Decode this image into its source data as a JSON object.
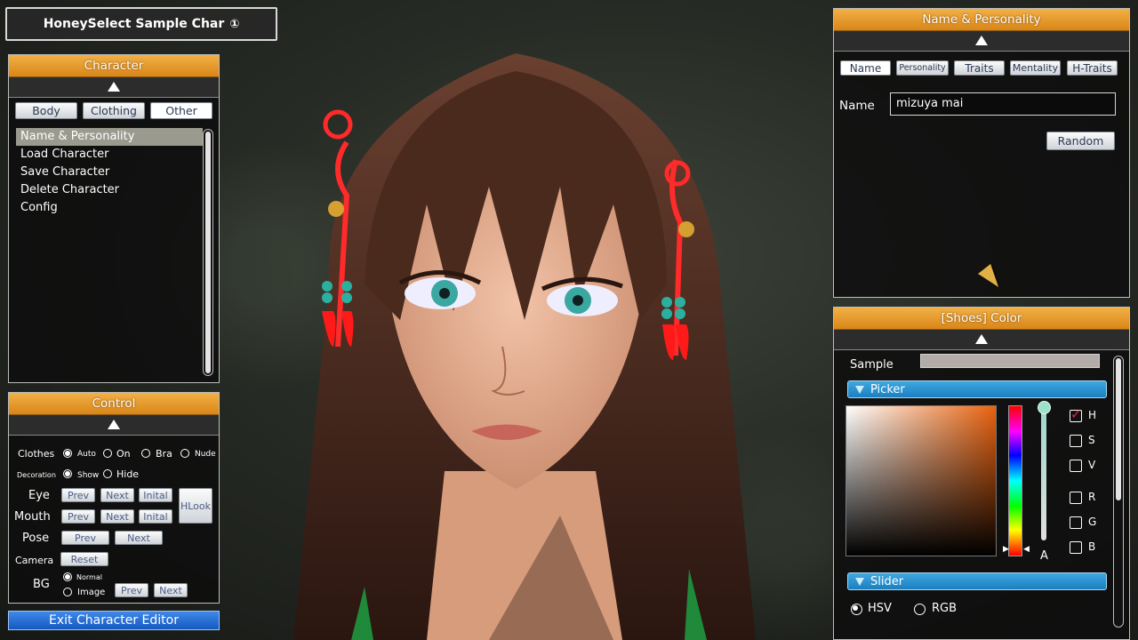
{
  "title": {
    "text": "HoneySelect Sample Char",
    "icon": "info-circle-icon",
    "icon_glyph": "①"
  },
  "character_panel": {
    "header": "Character",
    "tabs": [
      "Body",
      "Clothing",
      "Other"
    ],
    "active_tab": "Other",
    "items": [
      "Name & Personality",
      "Load Character",
      "Save Character",
      "Delete Character",
      "Config"
    ],
    "selected_item": "Name & Personality"
  },
  "control_panel": {
    "header": "Control",
    "clothes": {
      "label": "Clothes",
      "options": [
        "Auto",
        "On",
        "Bra",
        "Nude"
      ],
      "selected": "Auto"
    },
    "decoration": {
      "label": "Decoration",
      "options": [
        "Show",
        "Hide"
      ],
      "selected": "Show"
    },
    "eye": {
      "label": "Eye",
      "buttons": [
        "Prev",
        "Next",
        "Inital"
      ]
    },
    "mouth": {
      "label": "Mouth",
      "buttons": [
        "Prev",
        "Next",
        "Inital"
      ]
    },
    "hlook": "HLook",
    "pose": {
      "label": "Pose",
      "buttons": [
        "Prev",
        "Next"
      ]
    },
    "camera": {
      "label": "Camera",
      "button": "Reset"
    },
    "bg": {
      "label": "BG",
      "options": [
        "Normal",
        "Image"
      ],
      "selected": "Normal",
      "buttons": [
        "Prev",
        "Next"
      ]
    }
  },
  "exit_button": "Exit Character Editor",
  "name_panel": {
    "header": "Name & Personality",
    "tabs": [
      "Name",
      "Personality",
      "Traits",
      "Mentality",
      "H-Traits"
    ],
    "active_tab": "Name",
    "name_label": "Name",
    "name_value": "mizuya mai",
    "random_button": "Random"
  },
  "color_panel": {
    "header": "[Shoes] Color",
    "sample_label": "Sample",
    "sample_color": "#b3aca9",
    "picker_label": "Picker",
    "channels": [
      "H",
      "S",
      "V",
      "R",
      "G",
      "B"
    ],
    "checked_channel": "H",
    "alpha_label": "A",
    "slider_label": "Slider",
    "modes": [
      "HSV",
      "RGB"
    ],
    "mode_selected": "HSV",
    "hue_color": "#e8620f"
  },
  "colors": {
    "accent_orange": "#e39a2c",
    "accent_blue": "#1f6ed0"
  }
}
